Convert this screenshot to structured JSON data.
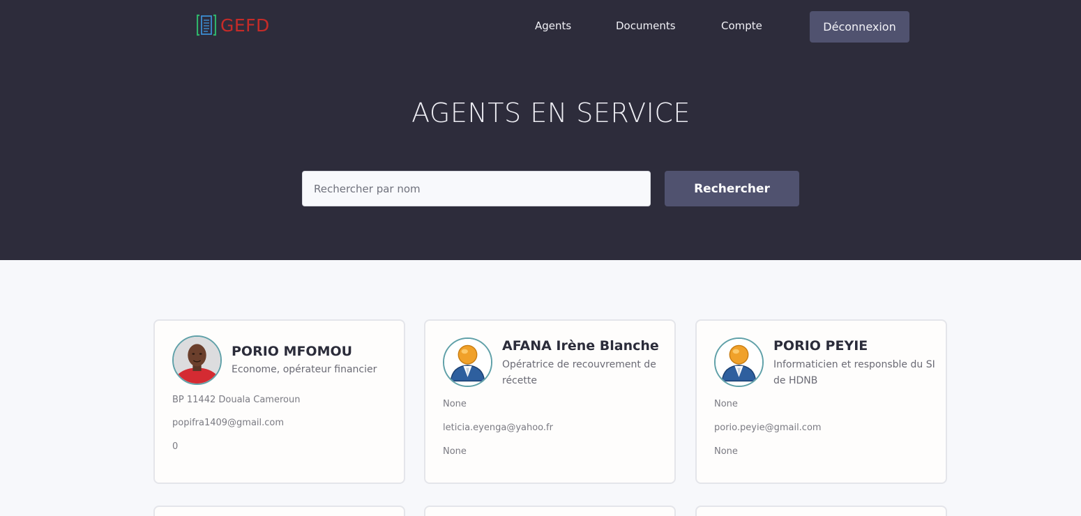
{
  "header": {
    "logo_text": "GEFD",
    "nav": {
      "agents": "Agents",
      "documents": "Documents",
      "compte": "Compte"
    },
    "logout_label": "Déconnexion"
  },
  "page": {
    "title": "AGENTS EN SERVICE",
    "search": {
      "placeholder": "Rechercher par nom",
      "value": "",
      "button_label": "Rechercher"
    }
  },
  "agents": [
    {
      "name": "PORIO MFOMOU",
      "role": "Econome, opérateur financier",
      "address": "BP 11442 Douala Cameroun",
      "email": "popifra1409@gmail.com",
      "phone": "0",
      "avatar": "photo"
    },
    {
      "name": "AFANA Irène Blanche",
      "role": "Opératrice de recouvrement de récette",
      "address": "None",
      "email": "leticia.eyenga@yahoo.fr",
      "phone": "None",
      "avatar": "default-user-icon"
    },
    {
      "name": "PORIO PEYIE",
      "role": "Informaticien et responsble du SI de HDNB",
      "address": "None",
      "email": "porio.peyie@gmail.com",
      "phone": "None",
      "avatar": "default-user-icon"
    }
  ],
  "colors": {
    "hero_bg": "#2d2c3b",
    "button_bg": "#50526f",
    "logo_red": "#c62b28",
    "page_bg": "#f7f8fb"
  }
}
